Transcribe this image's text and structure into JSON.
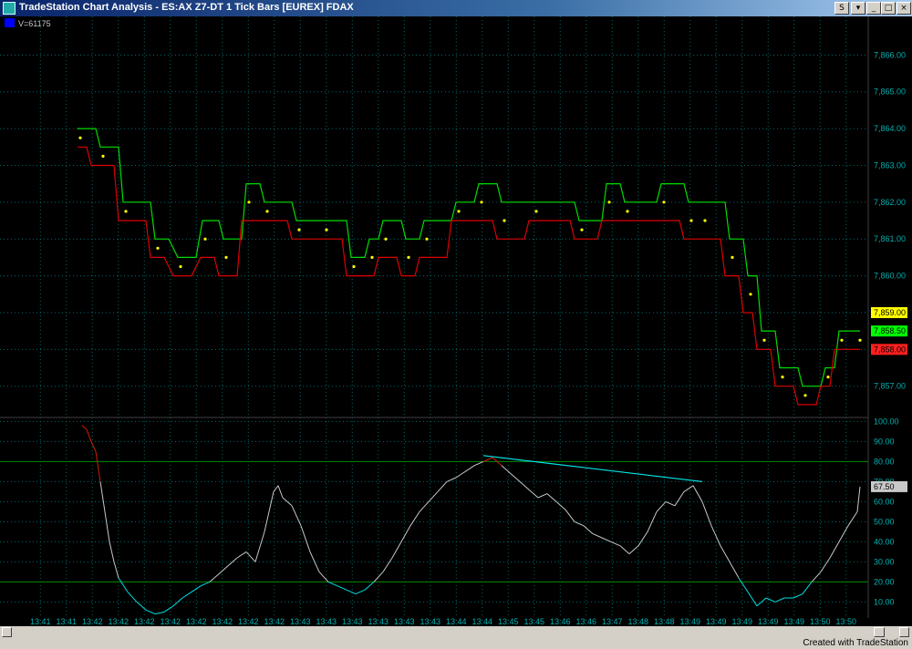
{
  "window": {
    "title": "TradeStation Chart Analysis - ES:AX Z7-DT  1 Tick Bars [EUREX] FDAX",
    "buttons": [
      "S",
      "▾",
      "_",
      "□",
      "×"
    ]
  },
  "volume_label": "V=61175",
  "credit": "Created with TradeStation",
  "colors": {
    "up": "#00dd00",
    "down": "#dd0000",
    "dots": "#ffff00",
    "grid": "#006b6b",
    "axis_text": "#00b0b0",
    "oscillator": "#c8c8c8",
    "oscillator_low": "#00e0e0",
    "oscillator_high": "#d02000",
    "trend": "#00e8e8",
    "level_line": "#008800"
  },
  "chart_data": [
    {
      "type": "line",
      "panel": "price",
      "y_ticks": [
        "7,866.00",
        "7,865.00",
        "7,864.00",
        "7,863.00",
        "7,862.00",
        "7,861.00",
        "7,860.00",
        "7,859.00",
        "7,858.00",
        "7,857.00"
      ],
      "ylim": [
        7856.2,
        7866.9
      ],
      "price_markers": [
        {
          "label": "7,859.00",
          "value": 7859.0,
          "color": "#ffff00"
        },
        {
          "label": "7,858.50",
          "value": 7858.5,
          "color": "#00ff00"
        },
        {
          "label": "7,858.00",
          "value": 7858.0,
          "color": "#ff2020"
        }
      ],
      "series": [
        {
          "color": "up",
          "x": [
            85,
            105,
            110,
            130,
            135,
            165,
            170,
            185,
            195,
            215,
            222,
            240,
            245,
            265,
            270,
            285,
            290,
            320,
            325,
            350,
            355,
            380,
            385,
            400,
            405,
            415,
            420,
            440,
            445,
            460,
            465,
            495,
            500,
            520,
            525,
            545,
            550,
            580,
            585,
            630,
            635,
            660,
            665,
            680,
            685,
            720,
            725,
            750,
            755,
            765,
            770,
            795,
            800,
            815,
            820,
            830,
            835,
            850,
            855,
            875,
            880,
            900,
            905,
            915,
            920,
            935,
            940,
            943
          ],
          "y": [
            7864.0,
            7864.0,
            7863.5,
            7863.5,
            7862.0,
            7862.0,
            7861.0,
            7861.0,
            7860.5,
            7860.5,
            7861.5,
            7861.5,
            7861.0,
            7861.0,
            7862.5,
            7862.5,
            7862.0,
            7862.0,
            7861.5,
            7861.5,
            7861.5,
            7861.5,
            7860.5,
            7860.5,
            7861.0,
            7861.0,
            7861.5,
            7861.5,
            7861.0,
            7861.0,
            7861.5,
            7861.5,
            7862.0,
            7862.0,
            7862.5,
            7862.5,
            7862.0,
            7862.0,
            7862.0,
            7862.0,
            7861.5,
            7861.5,
            7862.5,
            7862.5,
            7862.0,
            7862.0,
            7862.5,
            7862.5,
            7862.0,
            7862.0,
            7862.0,
            7862.0,
            7861.0,
            7861.0,
            7860.0,
            7860.0,
            7858.5,
            7858.5,
            7857.5,
            7857.5,
            7857.0,
            7857.0,
            7857.5,
            7857.5,
            7858.5,
            7858.5,
            7858.5,
            7858.5
          ]
        },
        {
          "color": "down",
          "x": [
            85,
            95,
            100,
            125,
            130,
            160,
            165,
            180,
            190,
            210,
            220,
            235,
            240,
            260,
            265,
            280,
            285,
            315,
            320,
            345,
            350,
            375,
            380,
            395,
            400,
            410,
            415,
            435,
            440,
            455,
            460,
            490,
            495,
            515,
            520,
            540,
            545,
            575,
            580,
            625,
            630,
            655,
            660,
            675,
            680,
            715,
            720,
            745,
            750,
            760,
            765,
            790,
            795,
            810,
            815,
            825,
            830,
            845,
            850,
            870,
            875,
            895,
            900,
            910,
            915,
            930,
            935,
            943
          ],
          "y": [
            7863.5,
            7863.5,
            7863.0,
            7863.0,
            7861.5,
            7861.5,
            7860.5,
            7860.5,
            7860.0,
            7860.0,
            7860.5,
            7860.5,
            7860.0,
            7860.0,
            7861.5,
            7861.5,
            7861.5,
            7861.5,
            7861.0,
            7861.0,
            7861.0,
            7861.0,
            7860.0,
            7860.0,
            7860.0,
            7860.0,
            7860.5,
            7860.5,
            7860.0,
            7860.0,
            7860.5,
            7860.5,
            7861.5,
            7861.5,
            7861.5,
            7861.5,
            7861.0,
            7861.0,
            7861.5,
            7861.5,
            7861.0,
            7861.0,
            7861.5,
            7861.5,
            7861.5,
            7861.5,
            7861.5,
            7861.5,
            7861.0,
            7861.0,
            7861.0,
            7861.0,
            7860.0,
            7860.0,
            7859.0,
            7859.0,
            7858.0,
            7858.0,
            7857.0,
            7857.0,
            7856.5,
            7856.5,
            7857.0,
            7857.0,
            7858.0,
            7858.0,
            7858.0,
            7858.0
          ]
        }
      ]
    },
    {
      "type": "line",
      "panel": "oscillator",
      "y_ticks": [
        "100.00",
        "90.00",
        "80.00",
        "70.00",
        "60.00",
        "50.00",
        "40.00",
        "30.00",
        "20.00",
        "10.00"
      ],
      "ylim": [
        2,
        102
      ],
      "levels": [
        80,
        20
      ],
      "last_value_label": "67.50",
      "last_value": 67.5,
      "series": [
        {
          "name": "",
          "x": [
            90,
            95,
            100,
            105,
            110,
            115,
            120,
            125,
            130,
            140,
            150,
            160,
            170,
            180,
            190,
            200,
            210,
            220,
            230,
            240,
            250,
            260,
            270,
            280,
            290,
            295,
            300,
            305,
            310,
            320,
            330,
            340,
            350,
            360,
            370,
            380,
            390,
            400,
            410,
            420,
            430,
            440,
            450,
            460,
            470,
            480,
            490,
            500,
            510,
            520,
            530,
            540,
            550,
            560,
            570,
            580,
            590,
            600,
            610,
            620,
            630,
            640,
            650,
            660,
            670,
            680,
            690,
            700,
            710,
            720,
            730,
            740,
            750,
            760,
            770,
            780,
            790,
            800,
            810,
            820,
            830,
            840,
            850,
            860,
            870,
            880,
            890,
            900,
            910,
            920,
            930,
            940,
            943
          ],
          "y": [
            98,
            96,
            90,
            85,
            70,
            55,
            40,
            30,
            22,
            15,
            10,
            6,
            4,
            5,
            8,
            12,
            15,
            18,
            20,
            24,
            28,
            32,
            35,
            30,
            45,
            55,
            65,
            68,
            62,
            58,
            48,
            35,
            25,
            20,
            18,
            16,
            14,
            16,
            20,
            25,
            32,
            40,
            48,
            55,
            60,
            65,
            70,
            72,
            75,
            78,
            80,
            82,
            78,
            74,
            70,
            66,
            62,
            64,
            60,
            56,
            50,
            48,
            44,
            42,
            40,
            38,
            34,
            38,
            45,
            55,
            60,
            58,
            65,
            68,
            60,
            48,
            38,
            30,
            22,
            15,
            8,
            12,
            10,
            12,
            12,
            14,
            20,
            25,
            32,
            40,
            48,
            55,
            67.5
          ]
        }
      ],
      "trendline": {
        "x": [
          530,
          770
        ],
        "y": [
          83,
          70
        ]
      }
    }
  ],
  "time_axis": {
    "labels": [
      "13:41",
      "13:41",
      "13:42",
      "13:42",
      "13:42",
      "13:42",
      "13:42",
      "13:42",
      "13:42",
      "13:42",
      "13:43",
      "13:43",
      "13:43",
      "13:43",
      "13:43",
      "13:43",
      "13:44",
      "13:44",
      "13:45",
      "13:45",
      "13:46",
      "13:46",
      "13:47",
      "13:48",
      "13:48",
      "13:49",
      "13:49",
      "13:49",
      "13:49",
      "13:49",
      "13:50",
      "13:50"
    ]
  }
}
